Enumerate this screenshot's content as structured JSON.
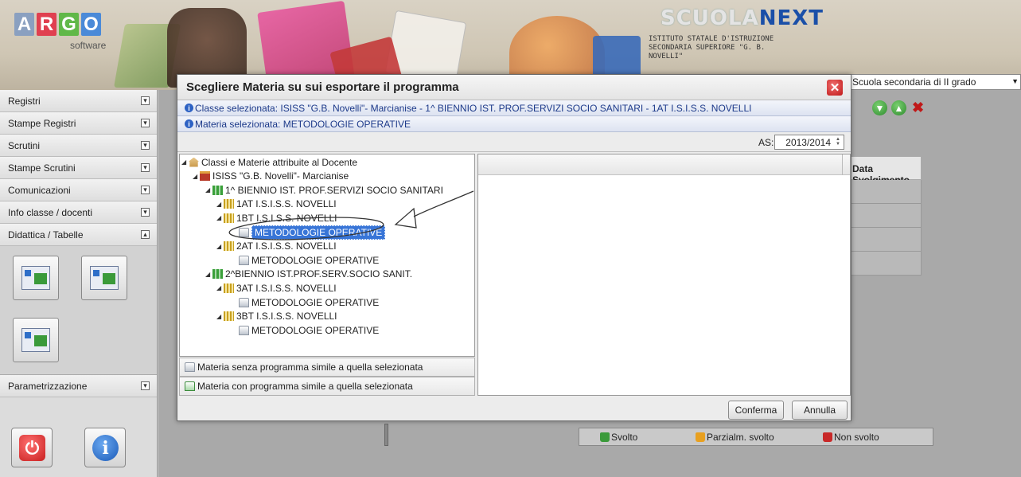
{
  "header": {
    "logo_letters": [
      {
        "ch": "A",
        "color": "#8aa0c0"
      },
      {
        "ch": "R",
        "color": "#e04050"
      },
      {
        "ch": "G",
        "color": "#60b848"
      },
      {
        "ch": "O",
        "color": "#4a8ad8"
      }
    ],
    "logo_sub": "software",
    "product_part1": "SCUOLA",
    "product_part2": "NEXT",
    "institute_lines": [
      "ISTITUTO STATALE D'ISTRUZIONE",
      "SECONDARIA SUPERIORE \"G. B.",
      "NOVELLI\""
    ],
    "school_type": "Scuola secondaria di II grado"
  },
  "sidebar": {
    "items": [
      {
        "label": "Registri",
        "expanded": false
      },
      {
        "label": "Stampe Registri",
        "expanded": false
      },
      {
        "label": "Scrutini",
        "expanded": false
      },
      {
        "label": "Stampe Scrutini",
        "expanded": false
      },
      {
        "label": "Comunicazioni",
        "expanded": false
      },
      {
        "label": "Info classe / docenti",
        "expanded": false
      },
      {
        "label": "Didattica / Tabelle",
        "expanded": true
      }
    ],
    "param_label": "Parametrizzazione",
    "expand_glyph": "▾",
    "collapse_glyph": "▴"
  },
  "background_table": {
    "column_header": "Data Svolgimento"
  },
  "dialog": {
    "title": "Scegliere Materia su sui esportare il programma",
    "info_class": "Classe selezionata: ISISS \"G.B. Novelli\"- Marcianise - 1^ BIENNIO IST. PROF.SERVIZI SOCIO SANITARI - 1AT I.S.I.S.S. NOVELLI",
    "info_subject": "Materia selezionata: METODOLOGIE OPERATIVE",
    "as_label": "AS:",
    "as_value": "2013/2014",
    "tree": [
      {
        "level": 0,
        "icon": "root",
        "label": "Classi e Materie attribuite al Docente",
        "selected": false
      },
      {
        "level": 1,
        "icon": "school",
        "label": "ISISS \"G.B. Novelli\"- Marcianise",
        "selected": false
      },
      {
        "level": 2,
        "icon": "biennio",
        "label": "1^ BIENNIO IST. PROF.SERVIZI SOCIO SANITARI",
        "selected": false
      },
      {
        "level": 3,
        "icon": "class",
        "label": "1AT I.S.I.S.S. NOVELLI",
        "selected": false
      },
      {
        "level": 3,
        "icon": "class",
        "label": "1BT I.S.I.S.S. NOVELLI",
        "selected": false
      },
      {
        "level": 4,
        "icon": "subject",
        "label": "METODOLOGIE OPERATIVE",
        "selected": true
      },
      {
        "level": 3,
        "icon": "class",
        "label": "2AT I.S.I.S.S. NOVELLI",
        "selected": false
      },
      {
        "level": 4,
        "icon": "subject",
        "label": "METODOLOGIE OPERATIVE",
        "selected": false
      },
      {
        "level": 2,
        "icon": "biennio",
        "label": "2^BIENNIO IST.PROF.SERV.SOCIO SANIT.",
        "selected": false
      },
      {
        "level": 3,
        "icon": "class",
        "label": "3AT I.S.I.S.S. NOVELLI",
        "selected": false
      },
      {
        "level": 4,
        "icon": "subject",
        "label": "METODOLOGIE OPERATIVE",
        "selected": false
      },
      {
        "level": 3,
        "icon": "class",
        "label": "3BT I.S.I.S.S. NOVELLI",
        "selected": false
      },
      {
        "level": 4,
        "icon": "subject",
        "label": "METODOLOGIE OPERATIVE",
        "selected": false
      }
    ],
    "legend_no_program": "Materia senza programma simile a quella selezionata",
    "legend_with_program": "Materia con programma simile a quella selezionata",
    "confirm_label": "Conferma",
    "cancel_label": "Annulla"
  },
  "status_legend": [
    {
      "label": "Svolto",
      "color": "#3a9a3a"
    },
    {
      "label": "Parzialm. svolto",
      "color": "#e8a020"
    },
    {
      "label": "Non svolto",
      "color": "#c82828"
    }
  ],
  "colors": {
    "selection": "#3875d7",
    "info_text": "#1d3a8a",
    "close_red": "#c01818"
  }
}
